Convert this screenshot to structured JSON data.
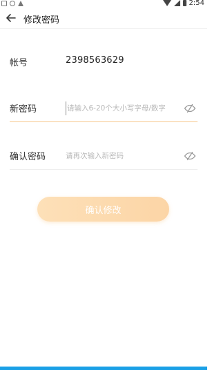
{
  "status_bar": {
    "time": "2:54"
  },
  "header": {
    "title": "修改密码"
  },
  "form": {
    "account": {
      "label": "帐号",
      "value": "2398563629"
    },
    "new_password": {
      "label": "新密码",
      "placeholder": "请输入6-20个大小写字母/数字",
      "value": ""
    },
    "confirm_password": {
      "label": "确认密码",
      "placeholder": "请再次输入新密码",
      "value": ""
    }
  },
  "actions": {
    "confirm_label": "确认修改"
  },
  "icons": {
    "back": "arrow-left-icon",
    "password_visibility": "eye-off-icon"
  },
  "colors": {
    "accent_line": "#f7c58a",
    "button_gradient_start": "#fde0b8",
    "button_gradient_end": "#fcd5a6",
    "bottom_bar": "#1aa0e6"
  }
}
